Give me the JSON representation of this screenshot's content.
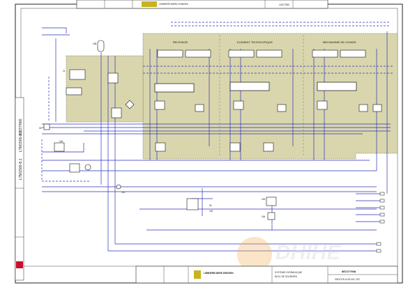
{
  "title_block_top": {
    "brand_text": "LIEBHERR-WERK EHINGEN",
    "drawing_number": "10227/900"
  },
  "side_strip": {
    "code_a": "LTM1500-8.1",
    "code_b": "LTM1500-8.1",
    "code_c": "10227/900"
  },
  "sections": {
    "lifting": "RELEVAGE",
    "telescope": "ELEMENT TELESCOPIQUE",
    "winch": "MECANISME DE LEVAGE"
  },
  "components": {
    "c158": "158",
    "c21": "21",
    "c55": "55",
    "c154": "154",
    "c161": "161",
    "c54": "54",
    "c162": "162",
    "c163": "163",
    "c164": "164"
  },
  "title_block_bottom": {
    "brand_text": "LIEBHERR-WERK EHINGEN",
    "description_line1": "SYSTEME HYDRAULIQUE",
    "description_line2": "BLOC DE SOUPAPES",
    "drawing_number": "987277908",
    "sheet_number": "3323-978.14.00.001- 002"
  },
  "watermark": {
    "text": "DHIHE"
  },
  "colors": {
    "line": "#2a2fb8",
    "panel": "#d9d6ad",
    "ink": "#111111",
    "accent_red": "#c8102e"
  }
}
